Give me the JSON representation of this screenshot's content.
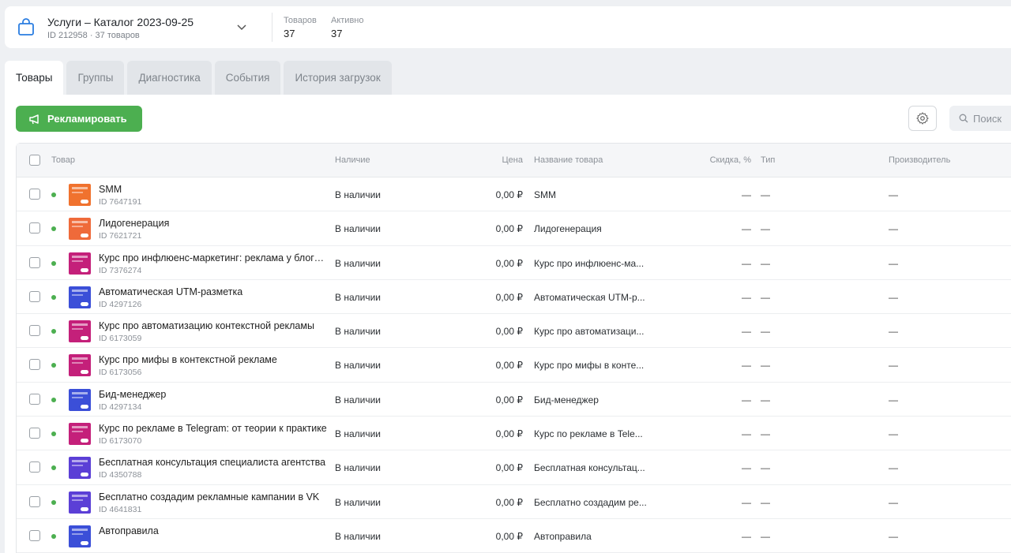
{
  "catalog": {
    "title": "Услуги – Каталог 2023-09-25",
    "subtitle": "ID 212958 · 37 товаров",
    "stats": [
      {
        "label": "Товаров",
        "value": "37"
      },
      {
        "label": "Активно",
        "value": "37"
      }
    ]
  },
  "tabs": [
    {
      "label": "Товары",
      "active": true
    },
    {
      "label": "Группы",
      "active": false
    },
    {
      "label": "Диагностика",
      "active": false
    },
    {
      "label": "События",
      "active": false
    },
    {
      "label": "История загрузок",
      "active": false
    }
  ],
  "toolbar": {
    "promote_label": "Рекламировать",
    "search_placeholder": "Поиск"
  },
  "table": {
    "headers": {
      "product": "Товар",
      "availability": "Наличие",
      "price": "Цена",
      "name": "Название товара",
      "discount": "Скидка, %",
      "type": "Тип",
      "manufacturer": "Производитель"
    },
    "rows": [
      {
        "name": "SMM",
        "id": "ID 7647191",
        "availability": "В наличии",
        "price": "0,00 ₽",
        "title": "SMM",
        "discount": "—",
        "type": "—",
        "manufacturer": "—",
        "thumb": "#f0722e"
      },
      {
        "name": "Лидогенерация",
        "id": "ID 7621721",
        "availability": "В наличии",
        "price": "0,00 ₽",
        "title": "Лидогенерация",
        "discount": "—",
        "type": "—",
        "manufacturer": "—",
        "thumb": "#ef6a3a"
      },
      {
        "name": "Курс про инфлюенс-маркетинг: реклама у блогеров",
        "id": "ID 7376274",
        "availability": "В наличии",
        "price": "0,00 ₽",
        "title": "Курс про инфлюенс-ма...",
        "discount": "—",
        "type": "—",
        "manufacturer": "—",
        "thumb": "#c4207a"
      },
      {
        "name": "Автоматическая UTM-разметка",
        "id": "ID 4297126",
        "availability": "В наличии",
        "price": "0,00 ₽",
        "title": "Автоматическая UTM-р...",
        "discount": "—",
        "type": "—",
        "manufacturer": "—",
        "thumb": "#3b4fd8"
      },
      {
        "name": "Курс про автоматизацию контекстной рекламы",
        "id": "ID 6173059",
        "availability": "В наличии",
        "price": "0,00 ₽",
        "title": "Курс про автоматизаци...",
        "discount": "—",
        "type": "—",
        "manufacturer": "—",
        "thumb": "#c4207a"
      },
      {
        "name": "Курс про мифы в контекстной рекламе",
        "id": "ID 6173056",
        "availability": "В наличии",
        "price": "0,00 ₽",
        "title": "Курс про мифы в конте...",
        "discount": "—",
        "type": "—",
        "manufacturer": "—",
        "thumb": "#c4207a"
      },
      {
        "name": "Бид-менеджер",
        "id": "ID 4297134",
        "availability": "В наличии",
        "price": "0,00 ₽",
        "title": "Бид-менеджер",
        "discount": "—",
        "type": "—",
        "manufacturer": "—",
        "thumb": "#3b4fd8"
      },
      {
        "name": "Курс по рекламе в Telegram: от теории к практике",
        "id": "ID 6173070",
        "availability": "В наличии",
        "price": "0,00 ₽",
        "title": "Курс по рекламе в Tele...",
        "discount": "—",
        "type": "—",
        "manufacturer": "—",
        "thumb": "#c4207a"
      },
      {
        "name": "Бесплатная консультация специалиста агентства",
        "id": "ID 4350788",
        "availability": "В наличии",
        "price": "0,00 ₽",
        "title": "Бесплатная консультац...",
        "discount": "—",
        "type": "—",
        "manufacturer": "—",
        "thumb": "#5b3fd6"
      },
      {
        "name": "Бесплатно создадим рекламные кампании в VK",
        "id": "ID 4641831",
        "availability": "В наличии",
        "price": "0,00 ₽",
        "title": "Бесплатно создадим ре...",
        "discount": "—",
        "type": "—",
        "manufacturer": "—",
        "thumb": "#5b3fd6"
      },
      {
        "name": "Автоправила",
        "id": "",
        "availability": "В наличии",
        "price": "0,00 ₽",
        "title": "Автоправила",
        "discount": "—",
        "type": "—",
        "manufacturer": "—",
        "thumb": "#3b4fd8"
      }
    ]
  },
  "colors": {
    "accent_green": "#4caf50",
    "background": "#eef0f3"
  }
}
